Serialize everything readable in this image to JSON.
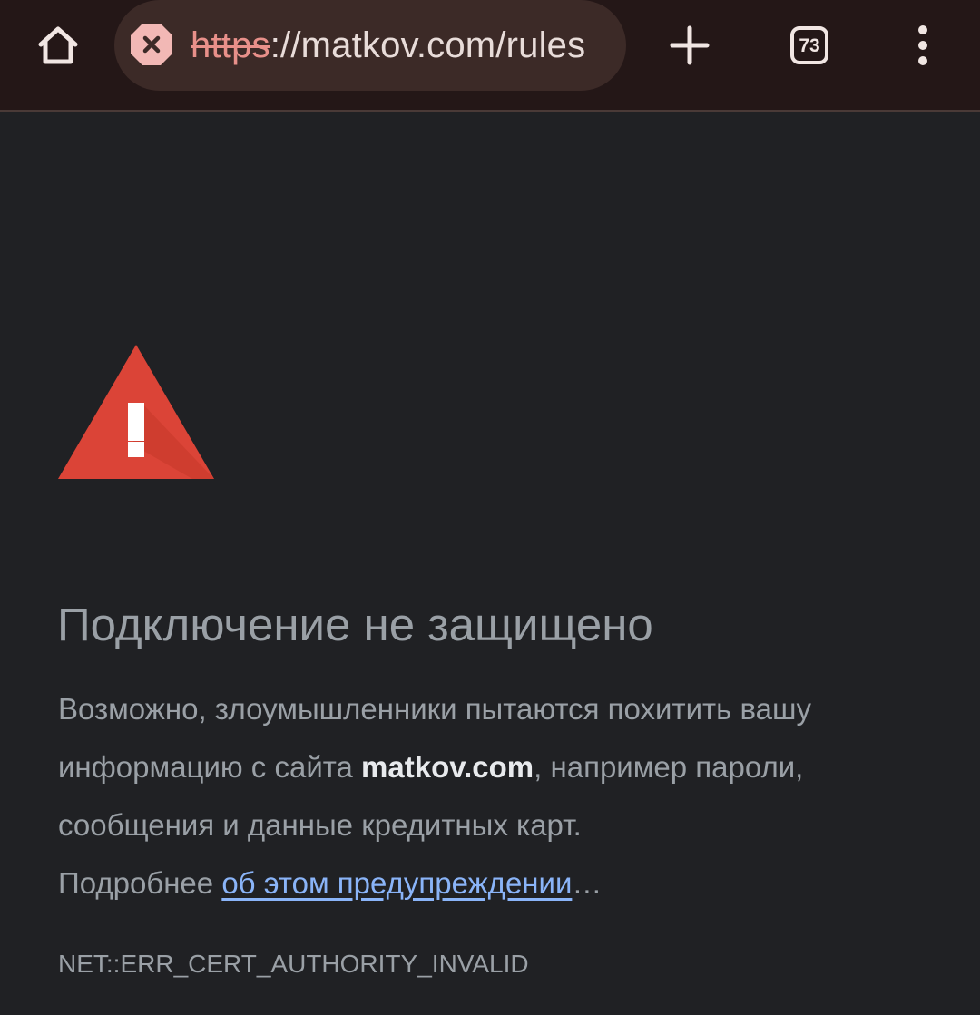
{
  "toolbar": {
    "url_scheme": "https",
    "url_rest": "://matkov.com/rules",
    "tab_count": "73",
    "icons": {
      "home": "home-icon",
      "security": "not-secure-icon",
      "new_tab": "plus-icon",
      "tabs": "tab-switcher-icon",
      "menu": "more-vert-icon"
    }
  },
  "interstitial": {
    "heading": "Подключение не защищено",
    "body_part1": "Возможно, злоумышленники пытаются похитить вашу информацию с сайта ",
    "domain": "matkov.com",
    "body_part2": ", например пароли, сообщения и данные кредитных карт.",
    "learn_more_prefix": "Подробнее ",
    "learn_more_link": "об этом предупреждении",
    "learn_more_suffix": "…",
    "error_code": "NET::ERR_CERT_AUTHORITY_INVALID"
  },
  "colors": {
    "page_background": "#202124",
    "toolbar_background": "#241717",
    "omnibox_background": "#3c2a27",
    "warning_red": "#db4437",
    "not_secure_pink": "#f2b8b5",
    "heading_text": "#9aa0a6",
    "link": "#8ab4f8"
  }
}
